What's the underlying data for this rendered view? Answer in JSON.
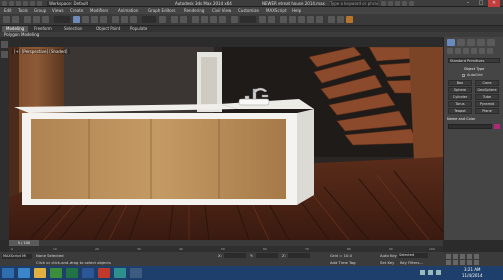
{
  "titlebar": {
    "workspace": "Workspace: Default",
    "app_title": "Autodesk 3ds Max  2014 x64",
    "file_title": "NEWER etreat house 2014.max",
    "search_placeholder": "Type a keyword or phrase"
  },
  "menu": {
    "items": [
      "Edit",
      "Tools",
      "Group",
      "Views",
      "Create",
      "Modifiers",
      "Animation",
      "Graph Editors",
      "Rendering",
      "Civil View",
      "Customize",
      "MAXScript",
      "Help"
    ]
  },
  "ribbon": {
    "tabs": [
      "Modeling",
      "Freeform",
      "Selection",
      "Object Paint",
      "Populate"
    ],
    "active_tab": "Modeling",
    "sub_label": "Polygon Modeling"
  },
  "viewport": {
    "label": "[+] [Perspective] [Shaded]"
  },
  "command_panel": {
    "dropdown": "Standard Primitives",
    "object_type_header": "Object Type",
    "autogrid_label": "AutoGrid",
    "buttons": [
      "Box",
      "Cone",
      "Sphere",
      "GeoSphere",
      "Cylinder",
      "Tube",
      "Torus",
      "Pyramid",
      "Teapot",
      "Plane"
    ],
    "name_color_header": "Name and Color",
    "color_swatch": "#b0287a"
  },
  "timeline": {
    "frame_label": "0 / 100",
    "ticks": [
      "0",
      "10",
      "20",
      "30",
      "40",
      "50",
      "60",
      "70",
      "80",
      "90",
      "100"
    ]
  },
  "status": {
    "selection": "None Selected",
    "prompt": "Click or click-and-drag to select objects",
    "x_label": "X:",
    "y_label": "Y:",
    "z_label": "Z:",
    "grid": "Grid = 10.0",
    "add_time_tag": "Add Time Tag",
    "auto_key": "Auto Key",
    "auto_key_mode": "Selected",
    "set_key": "Set Key",
    "key_filters": "Key Filters..."
  },
  "taskbar": {
    "time": "3:21 AM",
    "date": "11/4/2014"
  }
}
